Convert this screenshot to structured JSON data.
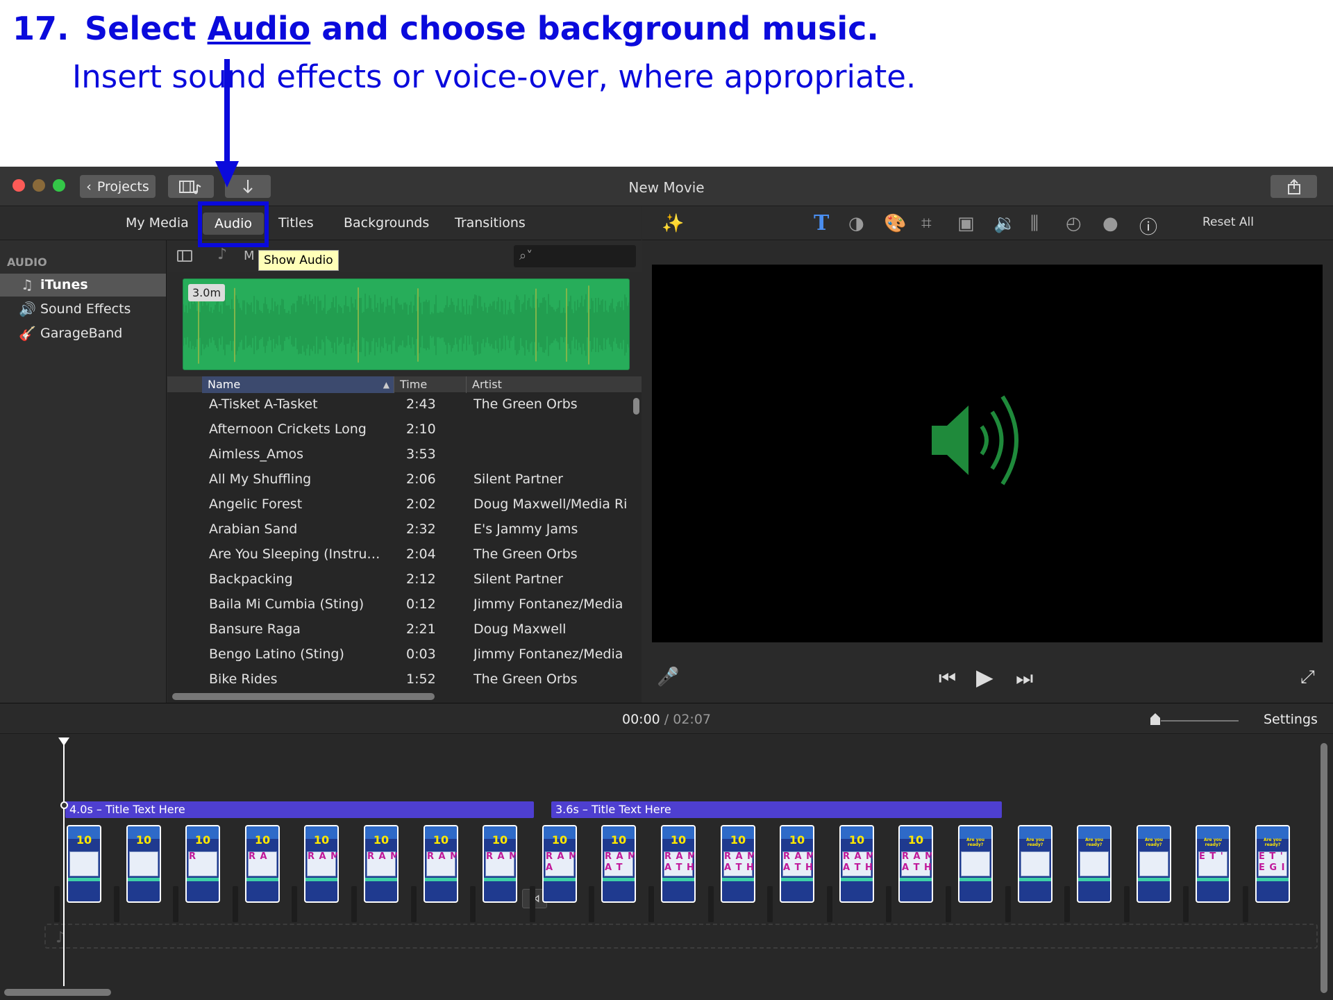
{
  "instruction": {
    "step_number": "17.",
    "line1_prefix": "Select",
    "line1_link": "Audio",
    "line1_suffix": "and choose background music.",
    "line2": "Insert sound effects or voice-over, where appropriate."
  },
  "window": {
    "title": "New Movie",
    "back_button_label": "Projects",
    "share_icon": "share-icon",
    "import_icon": "down-arrow-icon"
  },
  "browser_tabs": {
    "items": [
      "My Media",
      "Audio",
      "Titles",
      "Backgrounds",
      "Transitions"
    ],
    "selected": "Audio"
  },
  "sidebar": {
    "header": "AUDIO",
    "items": [
      {
        "label": "iTunes",
        "icon": "music-note-icon",
        "selected": true
      },
      {
        "label": "Sound Effects",
        "icon": "speaker-icon",
        "selected": false
      },
      {
        "label": "GarageBand",
        "icon": "guitar-icon",
        "selected": false
      }
    ]
  },
  "library": {
    "label_partial": "M",
    "search_placeholder": "",
    "tooltip": "Show Audio",
    "waveform_duration": "3.0m"
  },
  "table": {
    "columns": [
      "Name",
      "Time",
      "Artist"
    ],
    "sort_column": "Name",
    "rows": [
      {
        "name": "A-Tisket A-Tasket",
        "time": "2:43",
        "artist": "The Green Orbs"
      },
      {
        "name": "Afternoon Crickets Long",
        "time": "2:10",
        "artist": ""
      },
      {
        "name": "Aimless_Amos",
        "time": "3:53",
        "artist": ""
      },
      {
        "name": "All My Shuffling",
        "time": "2:06",
        "artist": "Silent Partner"
      },
      {
        "name": "Angelic Forest",
        "time": "2:02",
        "artist": "Doug Maxwell/Media Ri"
      },
      {
        "name": "Arabian Sand",
        "time": "2:32",
        "artist": "E's Jammy Jams"
      },
      {
        "name": "Are You Sleeping (Instru…",
        "time": "2:04",
        "artist": "The Green Orbs"
      },
      {
        "name": "Backpacking",
        "time": "2:12",
        "artist": "Silent Partner"
      },
      {
        "name": "Baila Mi Cumbia (Sting)",
        "time": "0:12",
        "artist": "Jimmy Fontanez/Media"
      },
      {
        "name": "Bansure Raga",
        "time": "2:21",
        "artist": "Doug Maxwell"
      },
      {
        "name": "Bengo Latino (Sting)",
        "time": "0:03",
        "artist": "Jimmy Fontanez/Media"
      },
      {
        "name": "Bike Rides",
        "time": "1:52",
        "artist": "The Green Orbs"
      }
    ]
  },
  "viewer": {
    "reset_label": "Reset All",
    "tools": [
      "magic-wand-icon",
      "text-icon",
      "color-balance-icon",
      "color-palette-icon",
      "crop-icon",
      "stabilization-camera-icon",
      "volume-icon",
      "equalizer-icon",
      "speed-icon",
      "filter-icon",
      "info-icon"
    ],
    "center_icon": "speaker-icon",
    "center_icon_color": "#1f8a3b"
  },
  "timeline": {
    "current_time": "00:00",
    "separator": "/",
    "total_time": "02:07",
    "settings_label": "Settings",
    "title_clips": [
      {
        "label": "4.0s – Title Text Here"
      },
      {
        "label": "3.6s – Title Text Here"
      }
    ],
    "clips": [
      {
        "num": "10",
        "letters": ""
      },
      {
        "num": "10",
        "letters": ""
      },
      {
        "num": "10",
        "letters": "R"
      },
      {
        "num": "10",
        "letters": "R A"
      },
      {
        "num": "10",
        "letters": "R A M"
      },
      {
        "num": "10",
        "letters": "R A M"
      },
      {
        "num": "10",
        "letters": "R A M"
      },
      {
        "num": "10",
        "letters": "R A M"
      },
      {
        "num": "10",
        "letters": "R A M\nA"
      },
      {
        "num": "10",
        "letters": "R A M\nA T"
      },
      {
        "num": "10",
        "letters": "R A M\nA T H"
      },
      {
        "num": "10",
        "letters": "R A M\nA T H"
      },
      {
        "num": "10",
        "letters": "R A M\nA T H"
      },
      {
        "num": "10",
        "letters": "R A M\nA T H"
      },
      {
        "num": "10",
        "letters": "R A M\nA T H"
      },
      {
        "num": "",
        "letters": "",
        "ready": "Are you ready?"
      },
      {
        "num": "",
        "letters": "",
        "ready": "Are you ready?"
      },
      {
        "num": "",
        "letters": "",
        "ready": "Are you ready?"
      },
      {
        "num": "",
        "letters": "",
        "ready": "Are you ready?"
      },
      {
        "num": "",
        "letters": "E T '",
        "ready": "Are you ready?"
      },
      {
        "num": "",
        "letters": "E T '\nE G I",
        "ready": "Are you ready?"
      }
    ]
  },
  "colors": {
    "annotation_blue": "#0a0adc",
    "waveform_green": "#27ad5a",
    "title_bar_purple": "#4e3fd0"
  }
}
